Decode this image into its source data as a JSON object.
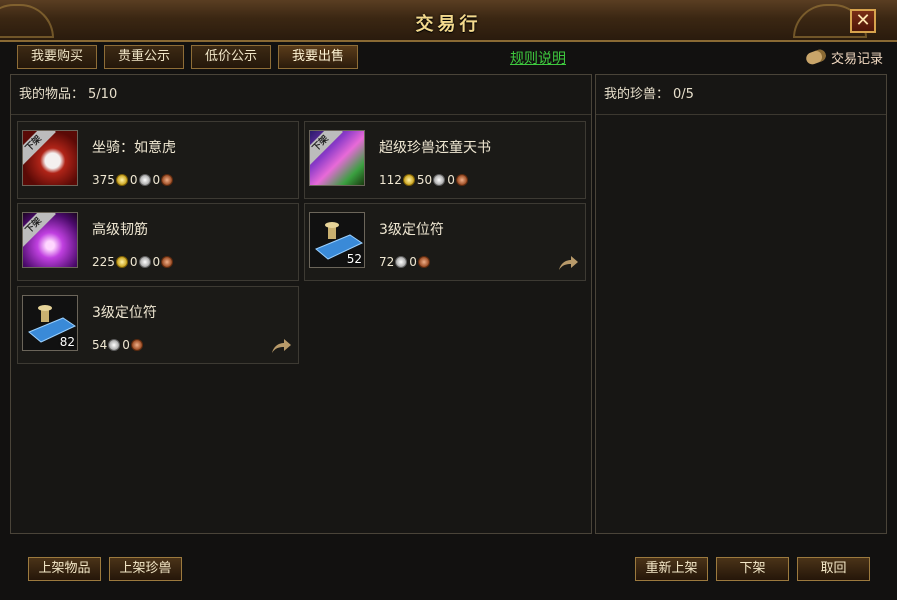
{
  "window": {
    "title": "交易行",
    "close_symbol": "✕"
  },
  "tabs": [
    {
      "label": "我要购买"
    },
    {
      "label": "贵重公示"
    },
    {
      "label": "低价公示"
    },
    {
      "label": "我要出售",
      "active": true
    }
  ],
  "rules_link": "规则说明",
  "records_label": "交易记录",
  "items_panel": {
    "label": "我的物品：",
    "count": "5/10"
  },
  "pets_panel": {
    "label": "我的珍兽：",
    "count": "0/5"
  },
  "items": [
    {
      "name": "坐骑：如意虎",
      "unlisted_badge": "下架",
      "quantity": "",
      "gold": "375",
      "silver": "0",
      "copper": "0",
      "icon": "tiger-mount-icon"
    },
    {
      "name": "超级珍兽还童天书",
      "unlisted_badge": "下架",
      "quantity": "",
      "gold": "112",
      "silver": "50",
      "copper": "0",
      "icon": "pet-book-icon"
    },
    {
      "name": "高级韧筋",
      "unlisted_badge": "下架",
      "quantity": "",
      "gold": "225",
      "silver": "0",
      "copper": "0",
      "icon": "tendon-icon"
    },
    {
      "name": "3级定位符",
      "unlisted_badge": "",
      "quantity": "52",
      "silver": "72",
      "copper": "0",
      "icon": "locator-talisman-icon"
    },
    {
      "name": "3级定位符",
      "unlisted_badge": "",
      "quantity": "82",
      "silver": "54",
      "copper": "0",
      "icon": "locator-talisman-icon"
    }
  ],
  "buttons": {
    "list_item": "上架物品",
    "list_pet": "上架珍兽",
    "relist": "重新上架",
    "delist": "下架",
    "withdraw": "取回"
  },
  "colors": {
    "accent_gold": "#f3d98d",
    "link_green": "#3ec83e",
    "panel_bg": "#171614"
  }
}
